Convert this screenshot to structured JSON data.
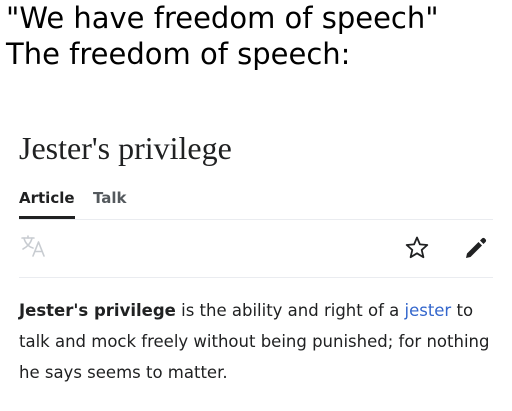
{
  "caption": {
    "line1": "\"We have freedom of speech\"",
    "line2": "The freedom of speech:"
  },
  "wiki": {
    "title": "Jester's privilege",
    "tabs": [
      {
        "label": "Article",
        "active": true
      },
      {
        "label": "Talk",
        "active": false
      }
    ],
    "toolbar": {
      "icons": [
        "language-icon",
        "star-icon",
        "edit-pencil-icon"
      ]
    },
    "summary": {
      "term": "Jester's privilege",
      "text_before_link": " is the ability and right of a ",
      "link_text": "jester",
      "text_after_link": " to talk and mock freely without being punished; for nothing he says seems to matter."
    }
  },
  "colors": {
    "text": "#202122",
    "tab_inactive": "#54595d",
    "link": "#3366cc",
    "divider": "#eaecf0",
    "icon_faint": "#c8ccd1"
  }
}
